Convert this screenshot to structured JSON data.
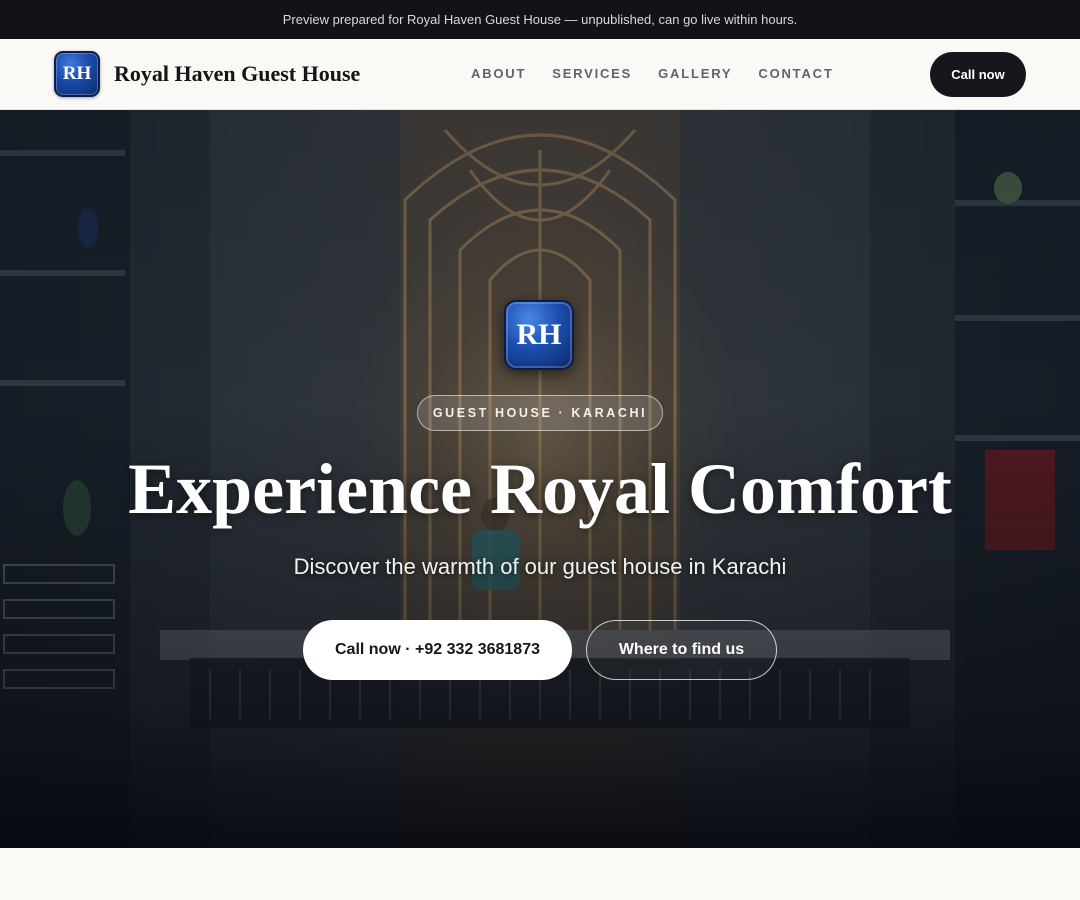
{
  "banner": {
    "text": "Preview prepared for Royal Haven Guest House — unpublished, can go live within hours."
  },
  "header": {
    "logo_initials": "RH",
    "brand_name": "Royal Haven Guest House",
    "nav": [
      {
        "label": "ABOUT"
      },
      {
        "label": "SERVICES"
      },
      {
        "label": "GALLERY"
      },
      {
        "label": "CONTACT"
      }
    ],
    "call_button": "Call now"
  },
  "hero": {
    "logo_initials": "RH",
    "tagline": "GUEST HOUSE · KARACHI",
    "title": "Experience Royal Comfort",
    "subtitle": "Discover the warmth of our guest house in Karachi",
    "primary_button": "Call now · +92 332 3681873",
    "secondary_button": "Where to find us"
  },
  "colors": {
    "banner_bg": "#121316",
    "header_bg": "#faf9f6",
    "dark_button": "#15171c",
    "logo_blue": "#1a4aa8",
    "nav_text": "#5c6470"
  }
}
